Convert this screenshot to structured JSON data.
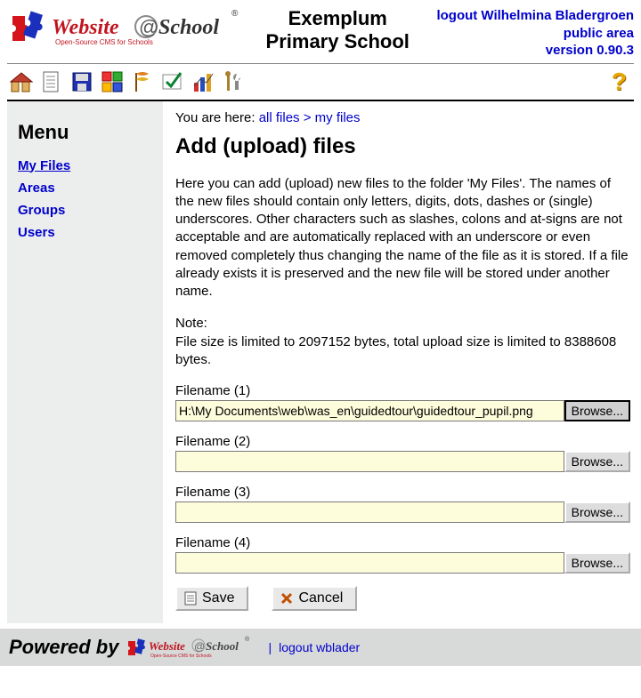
{
  "header": {
    "school_line1": "Exemplum",
    "school_line2": "Primary School",
    "logout_link": "logout Wilhelmina Bladergroen",
    "public_area_link": "public area",
    "version": "version 0.90.3"
  },
  "toolbar": {
    "icons": [
      "home",
      "page",
      "save",
      "puzzle",
      "flag",
      "check",
      "chart",
      "tools"
    ],
    "help": "?"
  },
  "breadcrumb": {
    "prefix": "You are here: ",
    "items": [
      "all files",
      "my files"
    ],
    "sep": " > "
  },
  "sidebar": {
    "title": "Menu",
    "items": [
      {
        "label": "My Files",
        "active": true
      },
      {
        "label": "Areas",
        "active": false
      },
      {
        "label": "Groups",
        "active": false
      },
      {
        "label": "Users",
        "active": false
      }
    ]
  },
  "page": {
    "title": "Add (upload) files",
    "paragraph1": "Here you can add (upload) new files to the folder 'My Files'. The names of the new files should contain only letters, digits, dots, dashes or (single) underscores. Other characters such as slashes, colons and at-signs are not acceptable and are automatically replaced with an underscore or even removed completely thus changing the name of the file as it is stored. If a file already exists it is preserved and the new file will be stored under another name.",
    "note_label": "Note:",
    "note_text": "File size is limited to 2097152 bytes, total upload size is limited to 8388608 bytes.",
    "fields": [
      {
        "label": "Filename (1)",
        "value": "H:\\My Documents\\web\\was_en\\guidedtour\\guidedtour_pupil.png",
        "browse": "Browse...",
        "active": true
      },
      {
        "label": "Filename (2)",
        "value": "",
        "browse": "Browse...",
        "active": false
      },
      {
        "label": "Filename (3)",
        "value": "",
        "browse": "Browse...",
        "active": false
      },
      {
        "label": "Filename (4)",
        "value": "",
        "browse": "Browse...",
        "active": false
      }
    ],
    "save": "Save",
    "cancel": "Cancel"
  },
  "footer": {
    "powered": "Powered by",
    "sep": "|",
    "logout": "logout wblader"
  }
}
